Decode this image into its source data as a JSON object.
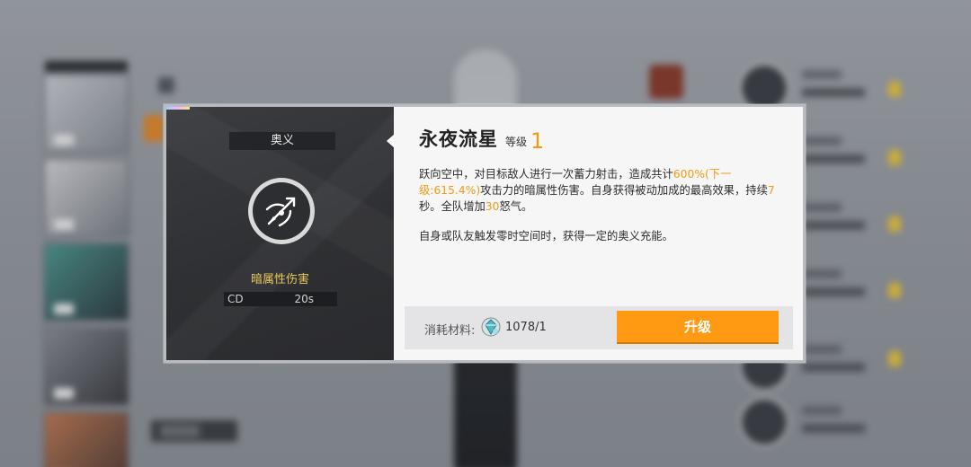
{
  "dialog": {
    "tag": "奥义",
    "skill_name": "永夜流星",
    "level_label": "等级",
    "level_value": "1",
    "damage_type": "暗属性伤害",
    "cd_label": "CD",
    "cd_value": "20s",
    "description": {
      "p1_a": "跃向空中，对目标敌人进行一次蓄力射击，造成共计",
      "p1_b": "600%(下一级:615.4%)",
      "p1_c": "攻击力的暗属性伤害。自身获得被动加成的最高效果，持续",
      "p1_d": "7",
      "p1_e": "秒。全队增加",
      "p1_f": "30",
      "p1_g": "怒气。",
      "p2": "自身或队友触发零时空间时，获得一定的奥义充能。"
    },
    "cost_label": "消耗材料:",
    "cost_qty": "1078/1",
    "upgrade_label": "升级"
  },
  "colors": {
    "accent": "#ff9a12",
    "highlight_text": "#f39a14",
    "damage_text": "#e8c95a",
    "panel_dark": "#2f3033"
  },
  "icons": {
    "skill": "meteor-spear-icon",
    "cost": "crystal-material-icon"
  }
}
